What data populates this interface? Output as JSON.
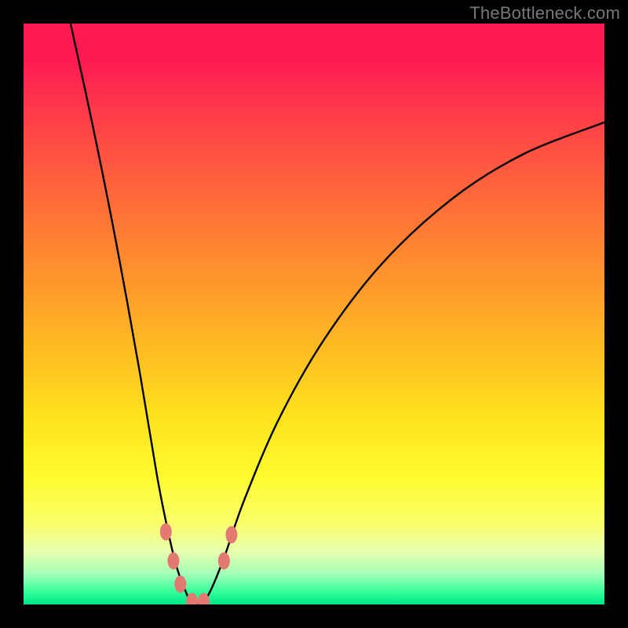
{
  "watermark": "TheBottleneck.com",
  "colors": {
    "frame": "#000000",
    "curve_stroke": "#000000",
    "marker_fill": "#e27a72",
    "marker_stroke": "#c4615a"
  },
  "chart_data": {
    "type": "line",
    "title": "",
    "xlabel": "",
    "ylabel": "",
    "xlim": [
      0,
      100
    ],
    "ylim": [
      0,
      100
    ],
    "note": "Unlabeled bottleneck-style curve over a vertical mismatch-severity gradient (red=bad at top, green=good at bottom). Values are x/y in percent of plot area; y is percent from top (0=top, 100=bottom). Curve is a V/U with minimum near x≈29, y≈100.",
    "series": [
      {
        "name": "bottleneck-curve",
        "points": [
          {
            "x": 8.1,
            "y": 0.0
          },
          {
            "x": 12.0,
            "y": 18.0
          },
          {
            "x": 16.0,
            "y": 38.0
          },
          {
            "x": 20.0,
            "y": 60.0
          },
          {
            "x": 23.0,
            "y": 78.0
          },
          {
            "x": 25.0,
            "y": 88.0
          },
          {
            "x": 26.5,
            "y": 94.0
          },
          {
            "x": 28.0,
            "y": 98.0
          },
          {
            "x": 29.0,
            "y": 99.8
          },
          {
            "x": 30.5,
            "y": 99.8
          },
          {
            "x": 32.0,
            "y": 98.0
          },
          {
            "x": 34.5,
            "y": 92.0
          },
          {
            "x": 38.0,
            "y": 82.0
          },
          {
            "x": 44.0,
            "y": 68.0
          },
          {
            "x": 52.0,
            "y": 54.0
          },
          {
            "x": 62.0,
            "y": 41.0
          },
          {
            "x": 74.0,
            "y": 30.0
          },
          {
            "x": 86.0,
            "y": 22.5
          },
          {
            "x": 100.0,
            "y": 17.0
          }
        ]
      }
    ],
    "markers": [
      {
        "x": 24.5,
        "y": 87.5
      },
      {
        "x": 25.8,
        "y": 92.5
      },
      {
        "x": 27.0,
        "y": 96.5
      },
      {
        "x": 29.0,
        "y": 99.5
      },
      {
        "x": 31.0,
        "y": 99.5
      },
      {
        "x": 34.5,
        "y": 92.5
      },
      {
        "x": 35.8,
        "y": 88.0
      }
    ],
    "gradient_stops": [
      {
        "pos": 0.0,
        "color": "#ff1a52"
      },
      {
        "pos": 0.3,
        "color": "#ff6a3a"
      },
      {
        "pos": 0.55,
        "color": "#ffb923"
      },
      {
        "pos": 0.78,
        "color": "#fffb2f"
      },
      {
        "pos": 0.95,
        "color": "#9dffb7"
      },
      {
        "pos": 1.0,
        "color": "#00e58a"
      }
    ]
  }
}
